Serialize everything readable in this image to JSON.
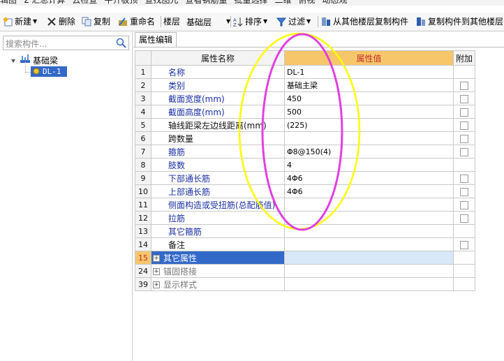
{
  "top_toolbar": {
    "items": [
      "辑图",
      "Σ 汇总计算",
      "云检查",
      "平齐板顶",
      "查找图元",
      "查看钢筋量",
      "批量选择",
      "二维",
      "俯视",
      "动态观"
    ]
  },
  "toolbar": {
    "new": "新建",
    "delete": "删除",
    "copy": "复制",
    "rename": "重命名",
    "floor_label": "楼层",
    "floor_value": "基础层",
    "sort": "排序",
    "filter": "过滤",
    "copy_from_floor": "从其他楼层复制构件",
    "copy_to_floor": "复制构件到其他楼层"
  },
  "left_panel": {
    "search_placeholder": "搜索构件...",
    "tree_root": "基础梁",
    "tree_child": "DL-1"
  },
  "tab": {
    "label": "属性编辑"
  },
  "grid": {
    "col_name": "属性名称",
    "col_value": "属性值",
    "col_extra": "附加",
    "rows": [
      {
        "num": "1",
        "name": "名称",
        "value": "DL-1",
        "style": "blue",
        "checkbox": false
      },
      {
        "num": "2",
        "name": "类别",
        "value": "基础主梁",
        "style": "blue",
        "checkbox": true
      },
      {
        "num": "3",
        "name": "截面宽度(mm)",
        "value": "450",
        "style": "blue",
        "checkbox": true
      },
      {
        "num": "4",
        "name": "截面高度(mm)",
        "value": "500",
        "style": "blue",
        "checkbox": true
      },
      {
        "num": "5",
        "name": "轴线距梁左边线距离(mm)",
        "value": "(225)",
        "style": "black",
        "checkbox": true
      },
      {
        "num": "6",
        "name": "跨数量",
        "value": "",
        "style": "black",
        "checkbox": true
      },
      {
        "num": "7",
        "name": "箍筋",
        "value": "Φ8@150(4)",
        "style": "blue",
        "checkbox": true
      },
      {
        "num": "8",
        "name": "肢数",
        "value": "4",
        "style": "blue",
        "checkbox": false
      },
      {
        "num": "9",
        "name": "下部通长筋",
        "value": "4Φ6",
        "style": "blue",
        "checkbox": true
      },
      {
        "num": "10",
        "name": "上部通长筋",
        "value": "4Φ6",
        "style": "blue",
        "checkbox": true
      },
      {
        "num": "11",
        "name": "侧面构造或受扭筋(总配筋值)",
        "value": "",
        "style": "blue",
        "checkbox": true
      },
      {
        "num": "12",
        "name": "拉筋",
        "value": "",
        "style": "blue",
        "checkbox": true
      },
      {
        "num": "13",
        "name": "其它箍筋",
        "value": "",
        "style": "blue",
        "checkbox": false
      },
      {
        "num": "14",
        "name": "备注",
        "value": "",
        "style": "black",
        "checkbox": true
      }
    ],
    "group_rows": [
      {
        "num": "15",
        "name": "其它属性",
        "selected": true
      },
      {
        "num": "24",
        "name": "锚固搭接",
        "selected": false
      },
      {
        "num": "39",
        "name": "显示样式",
        "selected": false
      }
    ]
  },
  "colors": {
    "selection_blue": "#3369c8",
    "header_orange": "#f6c66b",
    "header_red_text": "#c42c2c",
    "annotation_yellow": "#ffff00",
    "annotation_magenta": "#e040e0"
  }
}
